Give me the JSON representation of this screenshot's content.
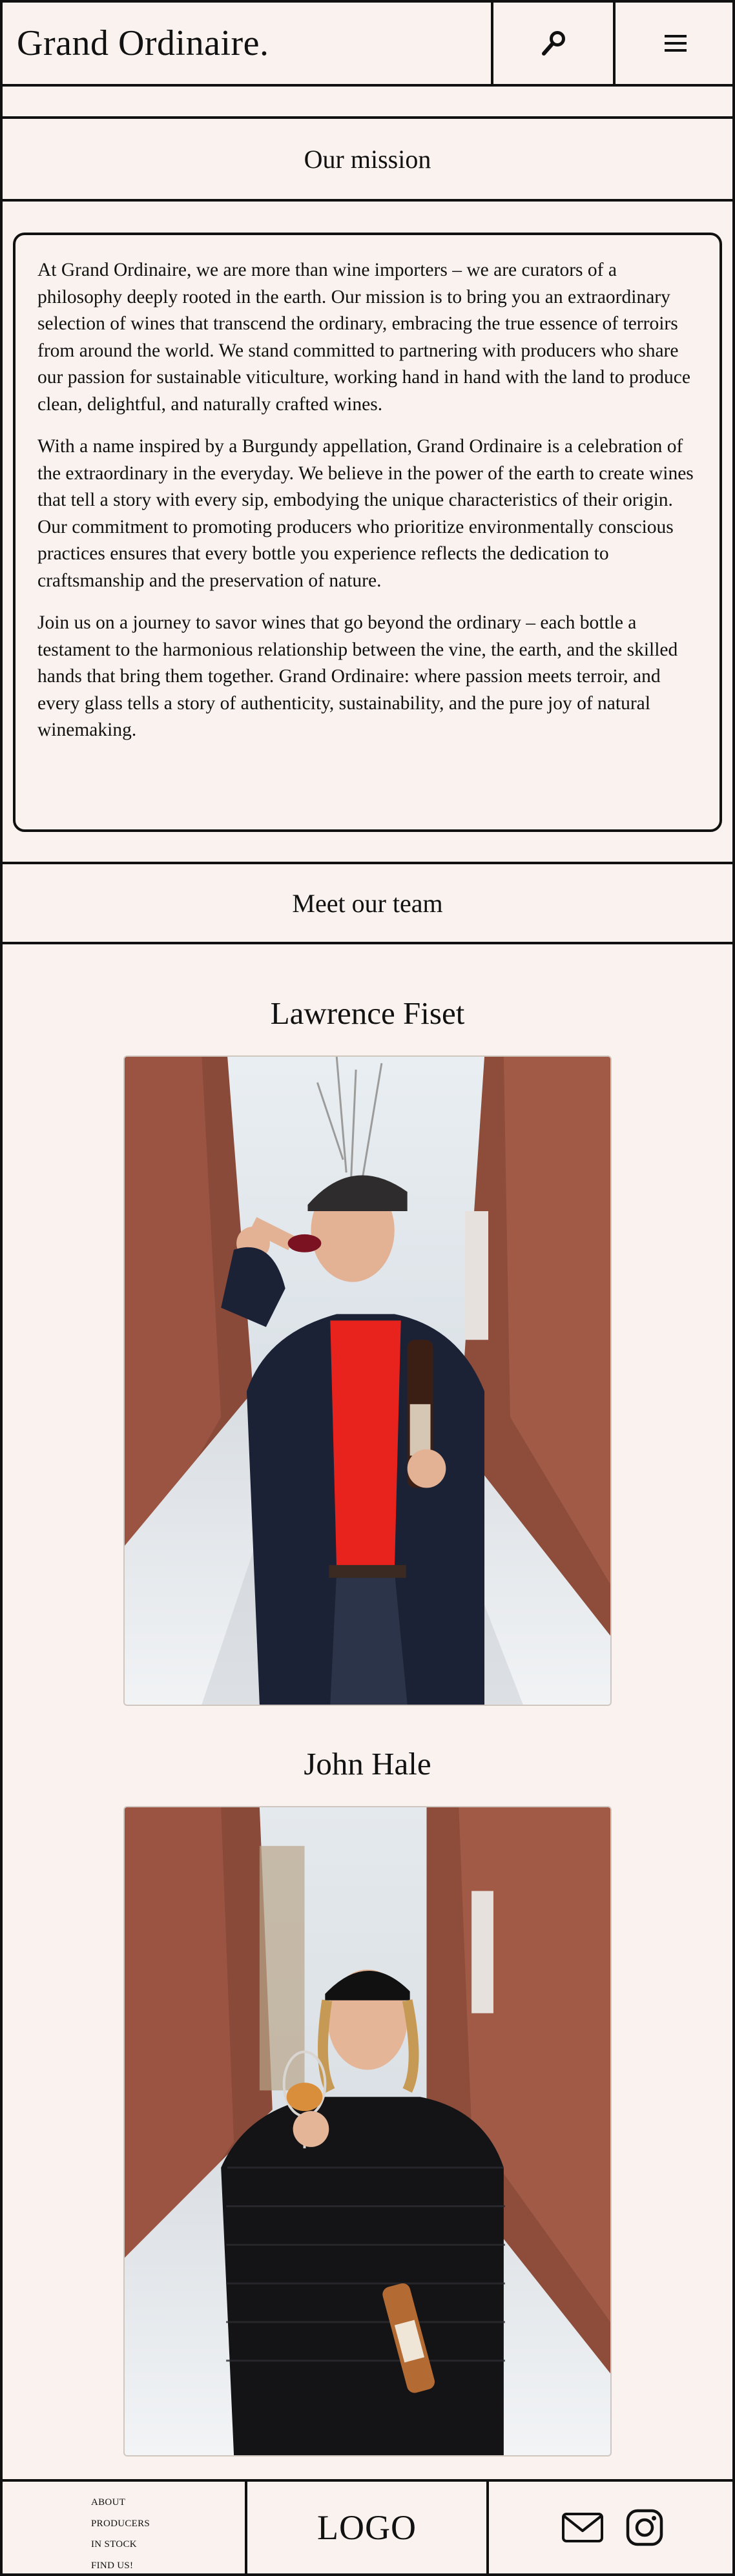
{
  "header": {
    "brand": "Grand Ordinaire.",
    "search_icon": "search-icon",
    "menu_icon": "hamburger-menu-icon"
  },
  "mission": {
    "heading": "Our mission",
    "paragraphs": [
      "At Grand Ordinaire, we are more than wine importers – we are curators of a philosophy deeply rooted in the earth. Our mission is to bring you an extraordinary selection of wines that transcend the ordinary, embracing the true essence of terroirs from around the world. We stand committed to partnering with producers who share our passion for sustainable viticulture, working hand in hand with the land to produce clean, delightful, and naturally crafted wines.",
      "With a name inspired by a Burgundy appellation, Grand Ordinaire is a celebration of the extraordinary in the everyday. We believe in the power of the earth to create wines that tell a story with every sip, embodying the unique characteristics of their origin. Our commitment to promoting producers who prioritize environmentally conscious practices ensures that every bottle you experience reflects the dedication to craftsmanship and the preservation of nature.",
      "Join us on a journey to savor wines that go beyond the ordinary – each bottle a testament to the harmonious relationship between the vine, the earth, and the skilled hands that bring them together. Grand Ordinaire: where passion meets terroir, and every glass tells a story of authenticity, sustainability, and the pure joy of natural winemaking."
    ]
  },
  "team": {
    "heading": "Meet our team",
    "members": [
      {
        "name": "Lawrence Fiset"
      },
      {
        "name": "John Hale"
      }
    ]
  },
  "footer": {
    "nav": [
      "ABOUT",
      "PRODUCERS",
      "IN STOCK",
      "FIND US!"
    ],
    "logo": "LOGO",
    "icons": [
      "mail-icon",
      "instagram-icon"
    ]
  },
  "colors": {
    "background": "#f9f2ee",
    "border": "#111111"
  }
}
